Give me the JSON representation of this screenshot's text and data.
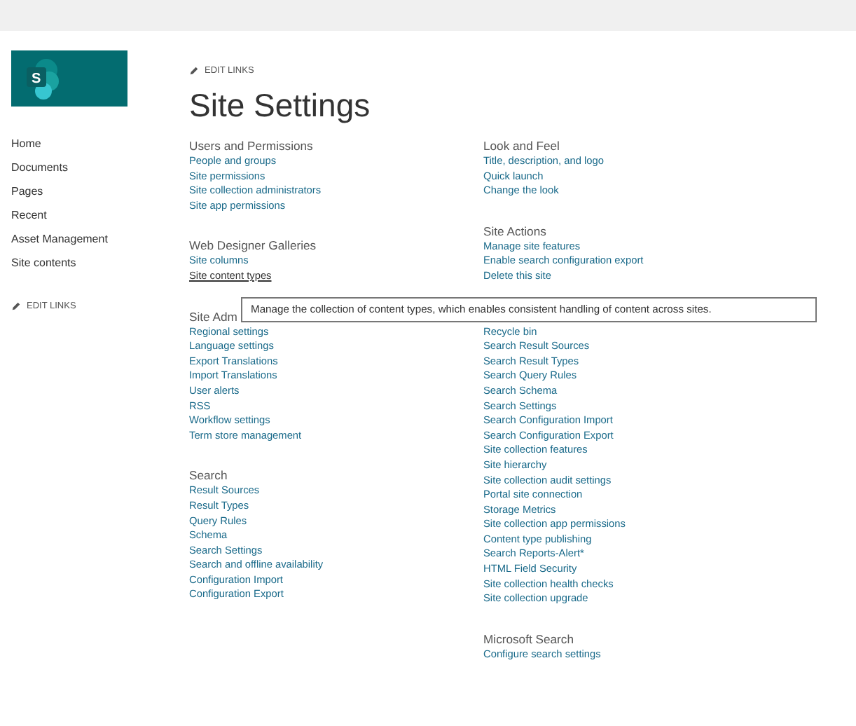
{
  "logo_letter": "S",
  "edit_links_top": "EDIT LINKS",
  "title": "Site Settings",
  "sidebar": {
    "items": [
      {
        "label": "Home"
      },
      {
        "label": "Documents"
      },
      {
        "label": "Pages"
      },
      {
        "label": "Recent"
      },
      {
        "label": "Asset Management"
      },
      {
        "label": "Site contents"
      }
    ],
    "edit_links": "EDIT LINKS"
  },
  "columns": [
    {
      "sections": [
        {
          "heading": "Users and Permissions",
          "links": [
            {
              "label": "People and groups",
              "hovered": false
            },
            {
              "label": "Site permissions",
              "hovered": false
            },
            {
              "label": "Site collection administrators",
              "hovered": false
            },
            {
              "label": "Site app permissions",
              "hovered": false
            }
          ]
        },
        {
          "heading": "Web Designer Galleries",
          "links": [
            {
              "label": "Site columns",
              "hovered": false
            },
            {
              "label": "Site content types",
              "hovered": true
            }
          ]
        },
        {
          "heading": "Site Adm",
          "links": [
            {
              "label": "Regional settings",
              "hovered": false
            },
            {
              "label": "Language settings",
              "hovered": false
            },
            {
              "label": "Export Translations",
              "hovered": false
            },
            {
              "label": "Import Translations",
              "hovered": false
            },
            {
              "label": "User alerts",
              "hovered": false
            },
            {
              "label": "RSS",
              "hovered": false
            },
            {
              "label": "Workflow settings",
              "hovered": false
            },
            {
              "label": "Term store management",
              "hovered": false
            }
          ]
        },
        {
          "heading": "Search",
          "links": [
            {
              "label": "Result Sources",
              "hovered": false
            },
            {
              "label": "Result Types",
              "hovered": false
            },
            {
              "label": "Query Rules",
              "hovered": false
            },
            {
              "label": "Schema",
              "hovered": false
            },
            {
              "label": "Search Settings",
              "hovered": false
            },
            {
              "label": "Search and offline availability",
              "hovered": false
            },
            {
              "label": "Configuration Import",
              "hovered": false
            },
            {
              "label": "Configuration Export",
              "hovered": false
            }
          ]
        }
      ]
    },
    {
      "sections": [
        {
          "heading": "Look and Feel",
          "links": [
            {
              "label": "Title, description, and logo",
              "hovered": false
            },
            {
              "label": "Quick launch",
              "hovered": false
            },
            {
              "label": "Change the look",
              "hovered": false
            }
          ]
        },
        {
          "heading": "Site Actions",
          "links": [
            {
              "label": "Manage site features",
              "hovered": false
            },
            {
              "label": "Enable search configuration export",
              "hovered": false
            },
            {
              "label": "Delete this site",
              "hovered": false
            }
          ]
        },
        {
          "links": [
            {
              "label": "Recycle bin",
              "hovered": false
            },
            {
              "label": "Search Result Sources",
              "hovered": false
            },
            {
              "label": "Search Result Types",
              "hovered": false
            },
            {
              "label": "Search Query Rules",
              "hovered": false
            },
            {
              "label": "Search Schema",
              "hovered": false
            },
            {
              "label": "Search Settings",
              "hovered": false
            },
            {
              "label": "Search Configuration Import",
              "hovered": false
            },
            {
              "label": "Search Configuration Export",
              "hovered": false
            },
            {
              "label": "Site collection features",
              "hovered": false
            },
            {
              "label": "Site hierarchy",
              "hovered": false
            },
            {
              "label": "Site collection audit settings",
              "hovered": false
            },
            {
              "label": "Portal site connection",
              "hovered": false
            },
            {
              "label": "Storage Metrics",
              "hovered": false
            },
            {
              "label": "Site collection app permissions",
              "hovered": false
            },
            {
              "label": "Content type publishing",
              "hovered": false
            },
            {
              "label": "Search Reports-Alert*",
              "hovered": false
            },
            {
              "label": "HTML Field Security",
              "hovered": false
            },
            {
              "label": "Site collection health checks",
              "hovered": false
            },
            {
              "label": "Site collection upgrade",
              "hovered": false
            }
          ]
        },
        {
          "heading": "Microsoft Search",
          "links": [
            {
              "label": "Configure search settings",
              "hovered": false
            }
          ]
        }
      ]
    }
  ],
  "tooltip": "Manage the collection of content types, which enables consistent handling of content across sites."
}
